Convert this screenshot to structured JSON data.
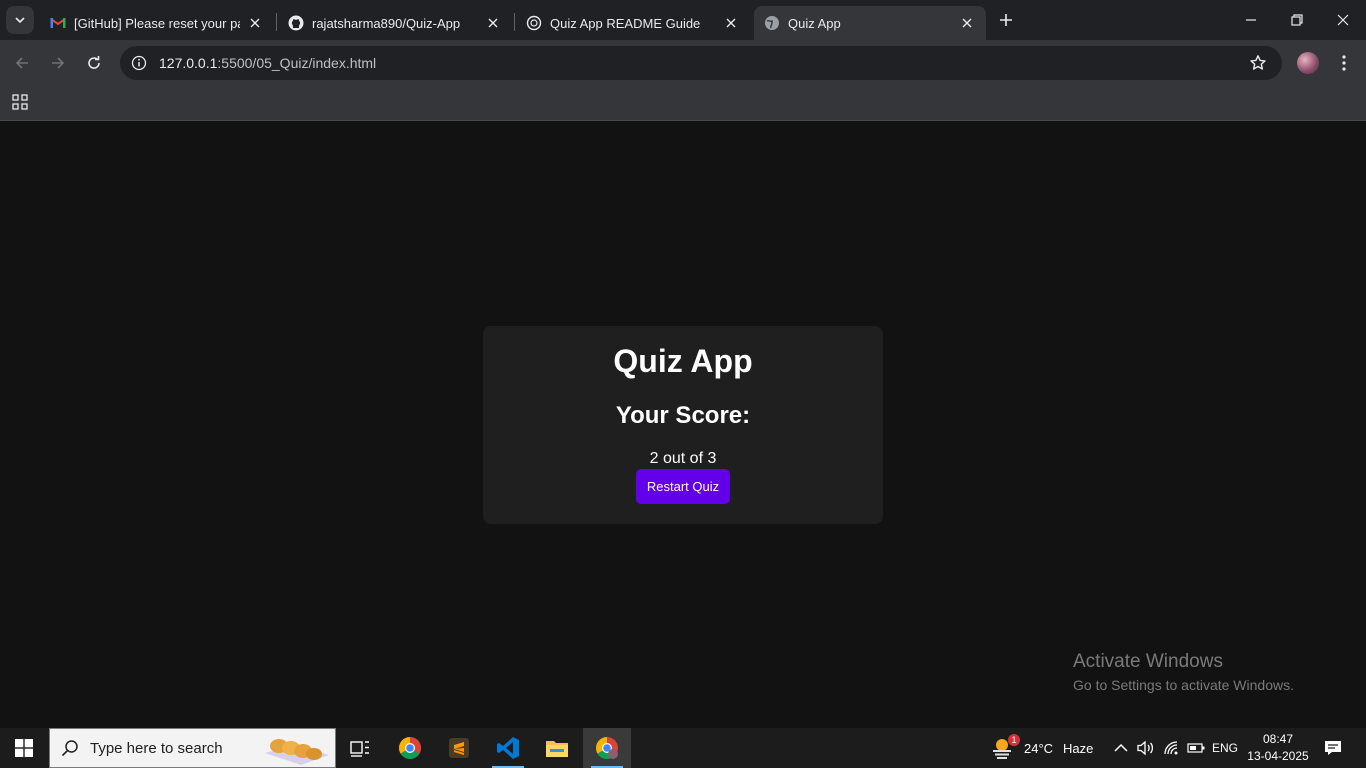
{
  "browser": {
    "tabs": [
      {
        "title": "[GitHub] Please reset your password",
        "favicon": "gmail-icon",
        "active": false
      },
      {
        "title": "rajatsharma890/Quiz-App",
        "favicon": "github-icon",
        "active": false
      },
      {
        "title": "Quiz App README Guide",
        "favicon": "chatgpt-icon",
        "active": false
      },
      {
        "title": "Quiz App",
        "favicon": "globe-icon",
        "active": true
      }
    ],
    "url_host": "127.0.0.1",
    "url_path": ":5500/05_Quiz/index.html"
  },
  "page": {
    "app_title": "Quiz App",
    "score_heading": "Your Score:",
    "score_text": "2 out of 3",
    "restart_label": "Restart Quiz",
    "accent_color": "#6200ea"
  },
  "watermark": {
    "title": "Activate Windows",
    "subtitle": "Go to Settings to activate Windows."
  },
  "taskbar": {
    "search_placeholder": "Type here to search",
    "weather_temp": "24°C",
    "weather_desc": "Haze",
    "weather_badge": "1",
    "language": "ENG",
    "time": "08:47",
    "date": "13-04-2025"
  }
}
